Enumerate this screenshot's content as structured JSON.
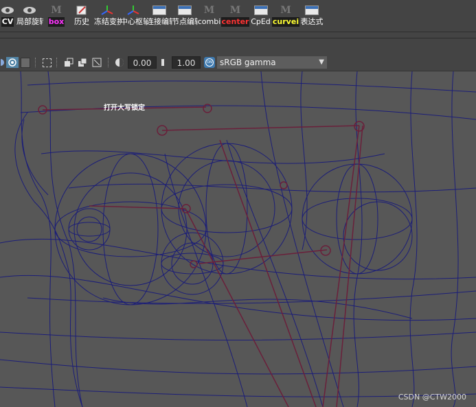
{
  "shelf": {
    "buttons": [
      {
        "label": "CV",
        "icon": "eye-icon",
        "style": "white"
      },
      {
        "label": "局部旋转",
        "icon": "eye-icon",
        "style": "white"
      },
      {
        "label": "box",
        "icon": "mel-script-icon",
        "style": "magenta"
      },
      {
        "label": "历史",
        "icon": "pencil-icon",
        "style": "white"
      },
      {
        "label": "冻结变换",
        "icon": "axes-icon",
        "style": "white"
      },
      {
        "label": "中心枢轴",
        "icon": "axes-icon",
        "style": "white"
      },
      {
        "label": "连接编辑器",
        "icon": "window-icon",
        "style": "white"
      },
      {
        "label": "节点编辑器",
        "icon": "window-icon",
        "style": "white"
      },
      {
        "label": "combi",
        "icon": "mel-script-icon",
        "style": "white"
      },
      {
        "label": "center",
        "icon": "mel-script-icon",
        "style": "red"
      },
      {
        "label": "CpEd",
        "icon": "window-icon",
        "style": "white"
      },
      {
        "label": "curvei",
        "icon": "mel-script-icon",
        "style": "yellow"
      },
      {
        "label": "表达式",
        "icon": "window-icon",
        "style": "white"
      }
    ]
  },
  "viewbar": {
    "exposure": "0.00",
    "gamma": "1.00",
    "color_management": "sRGB gamma"
  },
  "viewport": {
    "hud_text": "打开大写锁定",
    "watermark": "CSDN @CTW2000"
  },
  "colors": {
    "background": "#575757",
    "wire": "#1b1d78",
    "joint": "#6a1f3a"
  }
}
